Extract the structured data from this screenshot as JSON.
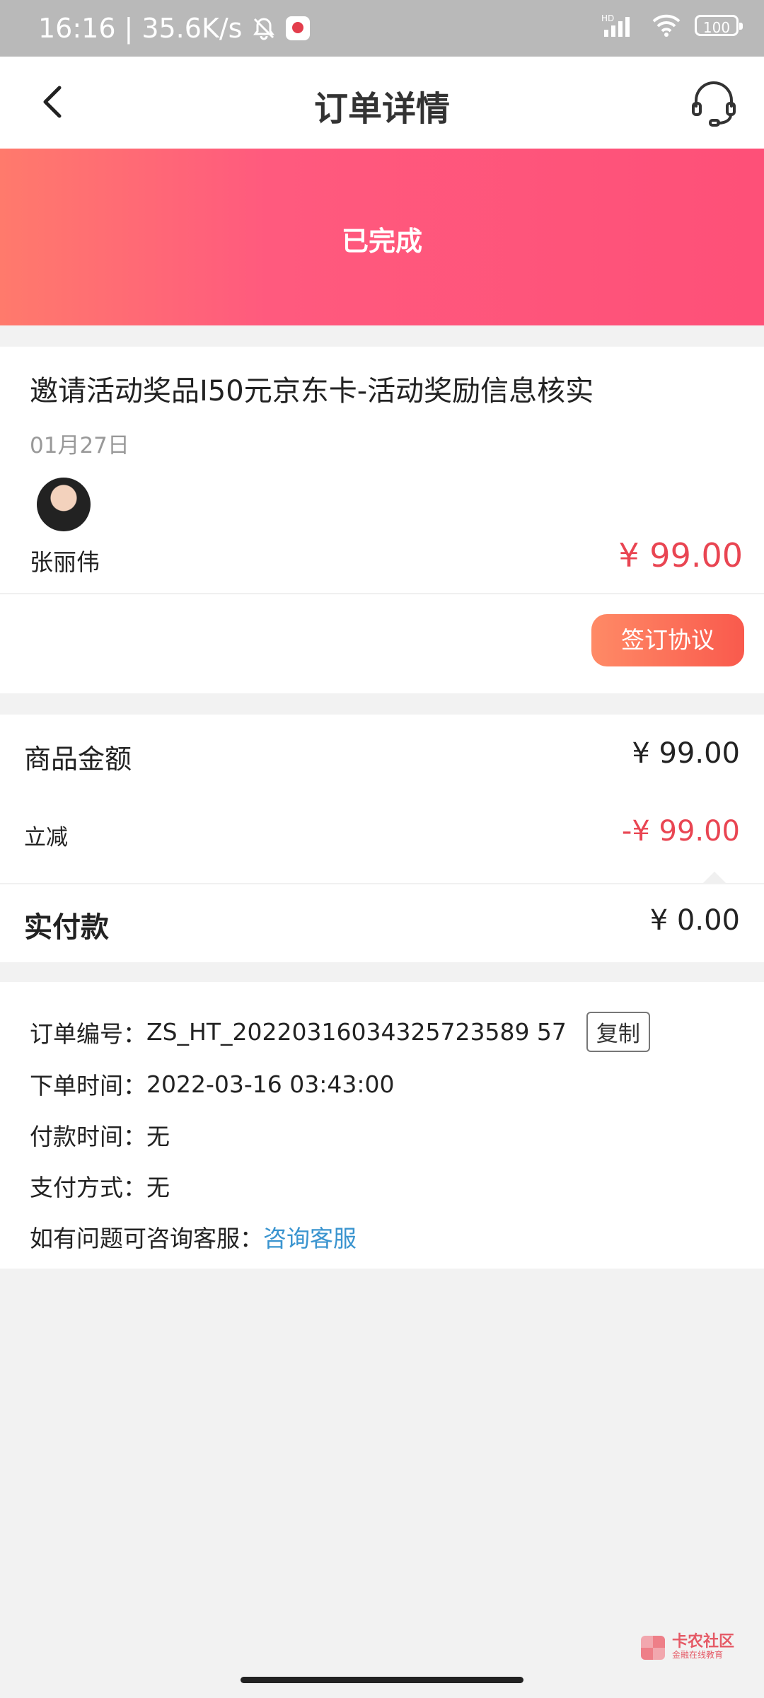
{
  "status_bar": {
    "time": "16:16",
    "net_speed": "35.6K/s",
    "signal_label": "HD",
    "battery": "100"
  },
  "header": {
    "title": "订单详情",
    "back_icon": "chevron-left-icon",
    "service_icon": "headset-icon"
  },
  "banner": {
    "status": "已完成",
    "gradient_colors": [
      "#ff7a6c",
      "#fe5078"
    ]
  },
  "order": {
    "product_title": "邀请活动奖品I50元京东卡-活动奖励信息核实",
    "date": "01月27日",
    "seller_name": "张丽伟",
    "price": "¥ 99.00",
    "sign_button": "签订协议"
  },
  "amounts": {
    "goods_label": "商品金额",
    "goods_value": "¥ 99.00",
    "discount_label": "立减",
    "discount_value": "-¥ 99.00",
    "paid_label": "实付款",
    "paid_value": "¥ 0.00"
  },
  "info": {
    "order_no_label": "订单编号：",
    "order_no_value": "ZS_HT_20220316034325723589 57",
    "copy_button": "复制",
    "order_time_label": "下单时间：",
    "order_time_value": "2022-03-16 03:43:00",
    "pay_time_label": "付款时间：",
    "pay_time_value": "无",
    "pay_method_label": "支付方式：",
    "pay_method_value": "无",
    "help_label": "如有问题可咨询客服：",
    "help_link": "咨询客服"
  },
  "watermark": {
    "main": "卡农社区",
    "sub": "金融在线教育"
  },
  "colors": {
    "accent_red": "#e94552",
    "link_blue": "#3a94cf"
  }
}
